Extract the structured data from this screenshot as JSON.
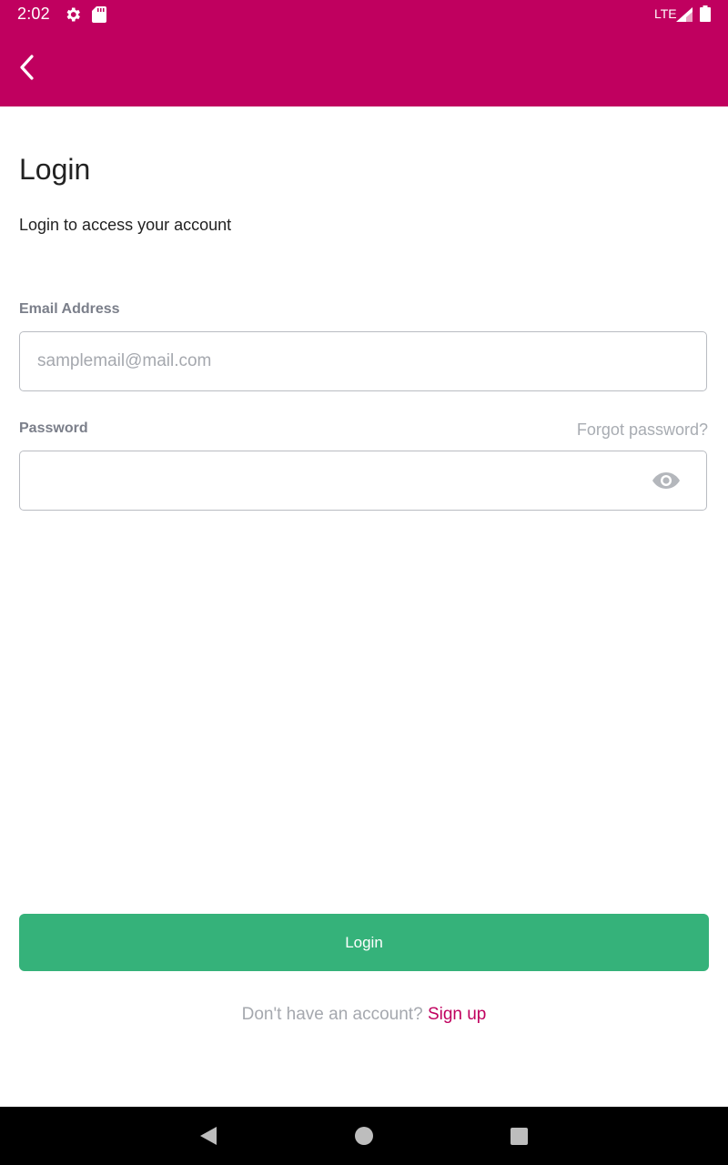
{
  "status_bar": {
    "time": "2:02",
    "network": "LTE",
    "icons": [
      "gear-icon",
      "sd-card-icon",
      "signal-icon",
      "battery-icon"
    ]
  },
  "header": {
    "back_icon": "chevron-left-icon",
    "color": "#c0005f"
  },
  "page": {
    "title": "Login",
    "subtitle": "Login to access your account"
  },
  "form": {
    "email": {
      "label": "Email Address",
      "placeholder": "samplemail@mail.com",
      "value": ""
    },
    "password": {
      "label": "Password",
      "placeholder": "",
      "value": "",
      "toggle_icon": "eye-icon"
    },
    "forgot_label": "Forgot password?",
    "submit_label": "Login",
    "submit_color": "#35b27a"
  },
  "footer": {
    "prompt": "Don't have an account?",
    "signup_label": "Sign up",
    "link_color": "#c0005f"
  },
  "nav_bar": {
    "icons": [
      "back-triangle-icon",
      "home-circle-icon",
      "recents-square-icon"
    ]
  }
}
